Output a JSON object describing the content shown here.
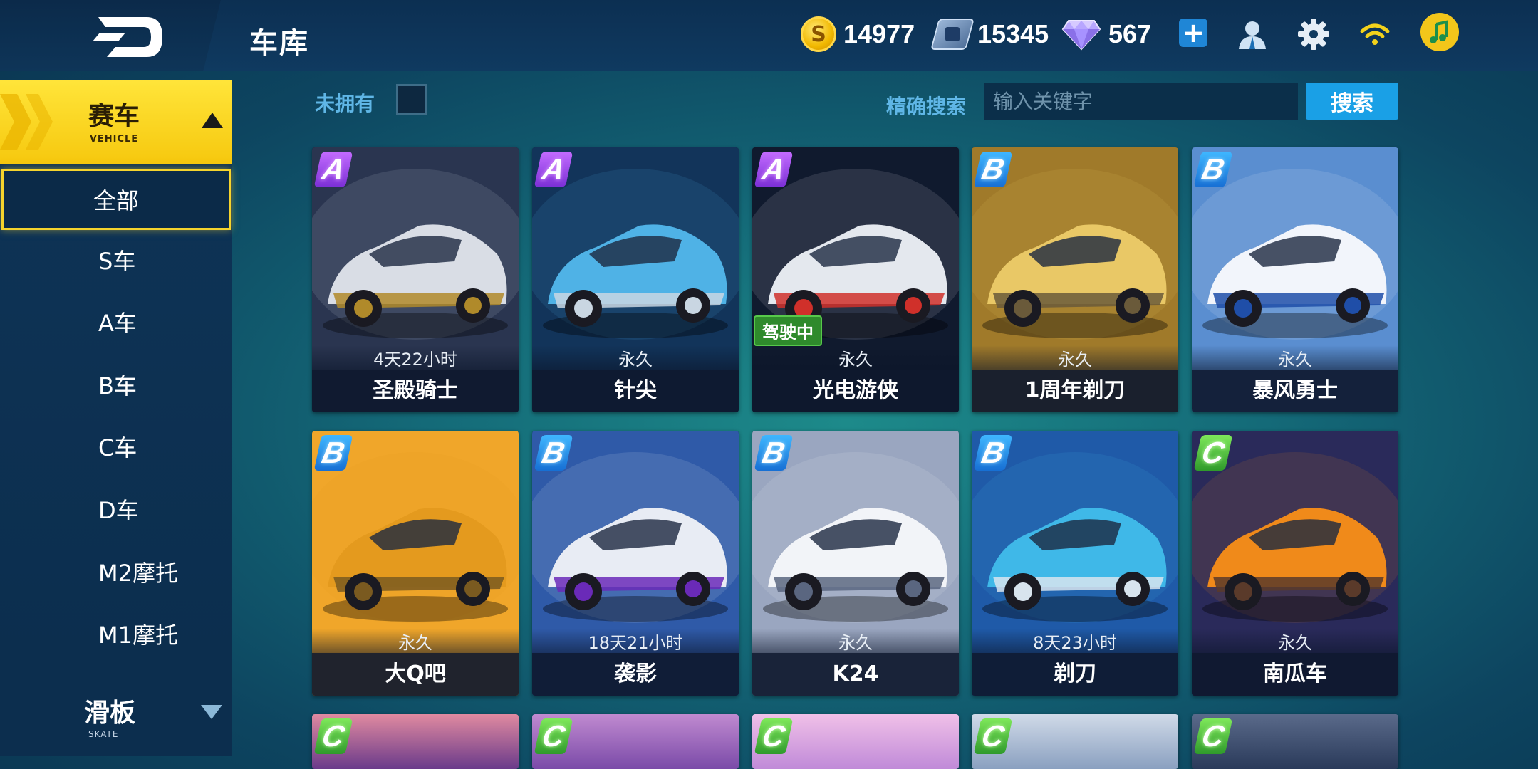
{
  "header": {
    "title": "车库",
    "gold": "14977",
    "coupons": "15345",
    "diamonds": "567",
    "plus_label": "+"
  },
  "sidebar": {
    "vehicle_category": {
      "label": "赛车",
      "sub": "VEHICLE"
    },
    "items": [
      {
        "label": "全部",
        "active": true
      },
      {
        "label": "S车"
      },
      {
        "label": "A车"
      },
      {
        "label": "B车"
      },
      {
        "label": "C车"
      },
      {
        "label": "D车"
      },
      {
        "label": "M2摩托"
      },
      {
        "label": "M1摩托"
      }
    ],
    "skate_category": {
      "label": "滑板",
      "sub": "SKATE"
    }
  },
  "filter": {
    "owned_label": "未拥有",
    "search_label": "精确搜索",
    "search_placeholder": "输入关键字",
    "search_button": "搜索"
  },
  "cars": [
    {
      "grade": "A",
      "duration": "4天22小时",
      "name": "圣殿骑士",
      "palette": [
        "#2a3550",
        "#d9dde5",
        "#b08a2a"
      ]
    },
    {
      "grade": "A",
      "duration": "永久",
      "name": "针尖",
      "palette": [
        "#12345a",
        "#4fb2e6",
        "#c9d6e2"
      ]
    },
    {
      "grade": "A",
      "duration": "永久",
      "name": "光电游侠",
      "driving_tag": "驾驶中",
      "palette": [
        "#101a2e",
        "#e4e8ee",
        "#d0302a"
      ]
    },
    {
      "grade": "B",
      "duration": "永久",
      "name": "1周年剃刀",
      "palette": [
        "#a07a2a",
        "#e9c866",
        "#6a5a3a"
      ]
    },
    {
      "grade": "B",
      "duration": "永久",
      "name": "暴风勇士",
      "palette": [
        "#5a8ed0",
        "#f2f5fb",
        "#1f4ea8"
      ]
    },
    {
      "grade": "B",
      "duration": "永久",
      "name": "大Q吧",
      "palette": [
        "#f0a62a",
        "#e49a1e",
        "#7a5a20"
      ]
    },
    {
      "grade": "B",
      "duration": "18天21小时",
      "name": "袭影",
      "palette": [
        "#2f5aa8",
        "#e8ecf4",
        "#6a2ab8"
      ]
    },
    {
      "grade": "B",
      "duration": "永久",
      "name": "K24",
      "palette": [
        "#9aa6c0",
        "#f2f4f8",
        "#5a6680"
      ]
    },
    {
      "grade": "B",
      "duration": "8天23小时",
      "name": "剃刀",
      "palette": [
        "#1f5aa8",
        "#3fb8e8",
        "#d8e4ee"
      ]
    },
    {
      "grade": "C",
      "duration": "永久",
      "name": "南瓜车",
      "palette": [
        "#2a2a5a",
        "#f08a1a",
        "#5a3a2a"
      ]
    }
  ],
  "partial_cards": [
    {
      "grade": "C",
      "palette": [
        "#6a3a8a",
        "#e08aa0"
      ]
    },
    {
      "grade": "C",
      "palette": [
        "#7a4aa8",
        "#c08ad0"
      ]
    },
    {
      "grade": "C",
      "palette": [
        "#c08ad8",
        "#f0c0e8"
      ]
    },
    {
      "grade": "C",
      "palette": [
        "#8aa0c0",
        "#d0dae8"
      ]
    },
    {
      "grade": "C",
      "palette": [
        "#2a3a5a",
        "#5a6a8a"
      ]
    }
  ],
  "icons": {
    "logo": "logo-icon",
    "gold": "coin-icon",
    "coupons": "coupon-icon",
    "diamonds": "diamond-icon",
    "friends": "friends-icon",
    "settings": "gear-icon",
    "wifi": "wifi-icon",
    "music": "music-icon"
  }
}
